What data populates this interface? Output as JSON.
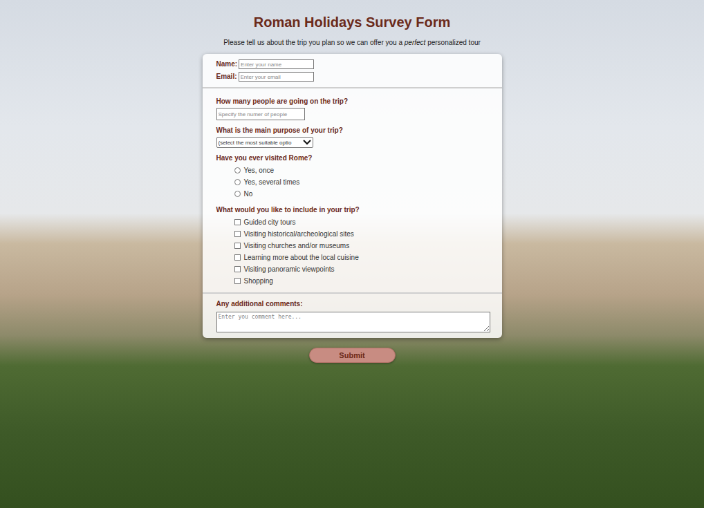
{
  "title": "Roman Holidays Survey Form",
  "subtitle": [
    {
      "text": "Please tell us about the trip you plan so we can offer you a ",
      "italic": false
    },
    {
      "text": "perfect",
      "italic": true
    },
    {
      "text": " personalized tour",
      "italic": false
    }
  ],
  "contact": [
    {
      "label": "Name:",
      "placeholder": "Enter your name"
    },
    {
      "label": "Email:",
      "placeholder": "Enter your email"
    }
  ],
  "questions": [
    {
      "kind": "number",
      "label": "How many people are going on the trip?",
      "placeholder": "Specify the numer of people"
    },
    {
      "kind": "select",
      "label": "What is the main purpose of your trip?",
      "value": "(select the most suitable optio"
    },
    {
      "kind": "radio",
      "label": "Have you ever visited Rome?",
      "options": [
        {
          "label": "Yes, once",
          "selected": false
        },
        {
          "label": "Yes, several times",
          "selected": false
        },
        {
          "label": "No",
          "selected": false
        }
      ]
    },
    {
      "kind": "checkbox",
      "label": "What would you like to include in your trip?",
      "options": [
        {
          "label": "Guided city tours",
          "checked": false
        },
        {
          "label": "Visiting historical/archeological sites",
          "checked": false
        },
        {
          "label": "Visiting churches and/or museums",
          "checked": false
        },
        {
          "label": "Learning more about the local cuisine",
          "checked": false
        },
        {
          "label": "Visiting panoramic viewpoints",
          "checked": false
        },
        {
          "label": "Shopping",
          "checked": false
        }
      ]
    }
  ],
  "comments": {
    "label": "Any additional comments:",
    "placeholder": "Enter you comment here..."
  },
  "submit": "Submit"
}
